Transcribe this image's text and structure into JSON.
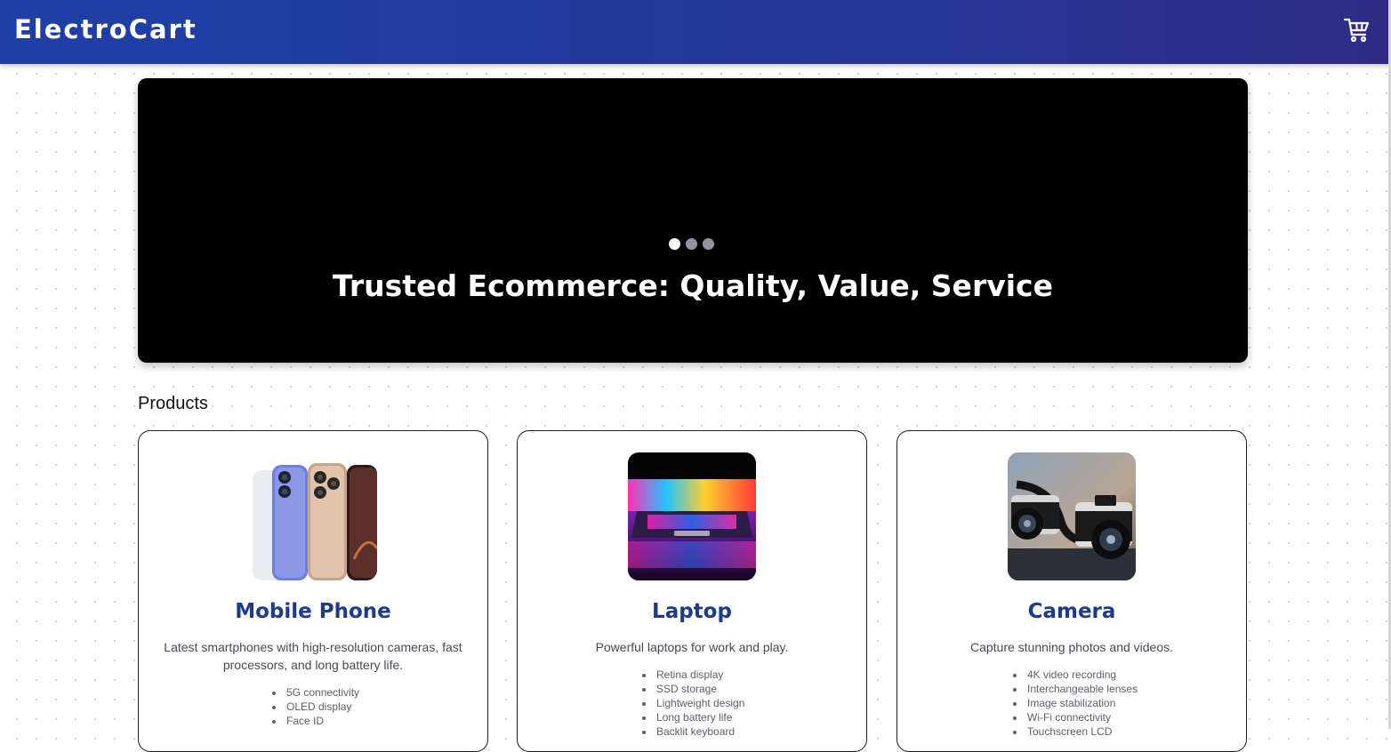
{
  "header": {
    "brand": "ElectroCart",
    "cart_icon": "cart-icon"
  },
  "hero": {
    "headline": "Trusted Ecommerce: Quality, Value, Service",
    "slides": 3,
    "active_slide": 1
  },
  "products": {
    "section_title": "Products",
    "items": [
      {
        "title": "Mobile Phone",
        "description": "Latest smartphones with high-resolution cameras, fast processors, and long battery life.",
        "features": [
          "5G connectivity",
          "OLED display",
          "Face ID"
        ]
      },
      {
        "title": "Laptop",
        "description": "Powerful laptops for work and play.",
        "features": [
          "Retina display",
          "SSD storage",
          "Lightweight design",
          "Long battery life",
          "Backlit keyboard"
        ]
      },
      {
        "title": "Camera",
        "description": "Capture stunning photos and videos.",
        "features": [
          "4K video recording",
          "Interchangeable lenses",
          "Image stabilization",
          "Wi-Fi connectivity",
          "Touchscreen LCD"
        ]
      }
    ]
  },
  "colors": {
    "header_gradient_start": "#1f3fa6",
    "header_gradient_end": "#2f2c86",
    "product_title": "#1e3a8a",
    "hero_background": "#000000"
  }
}
